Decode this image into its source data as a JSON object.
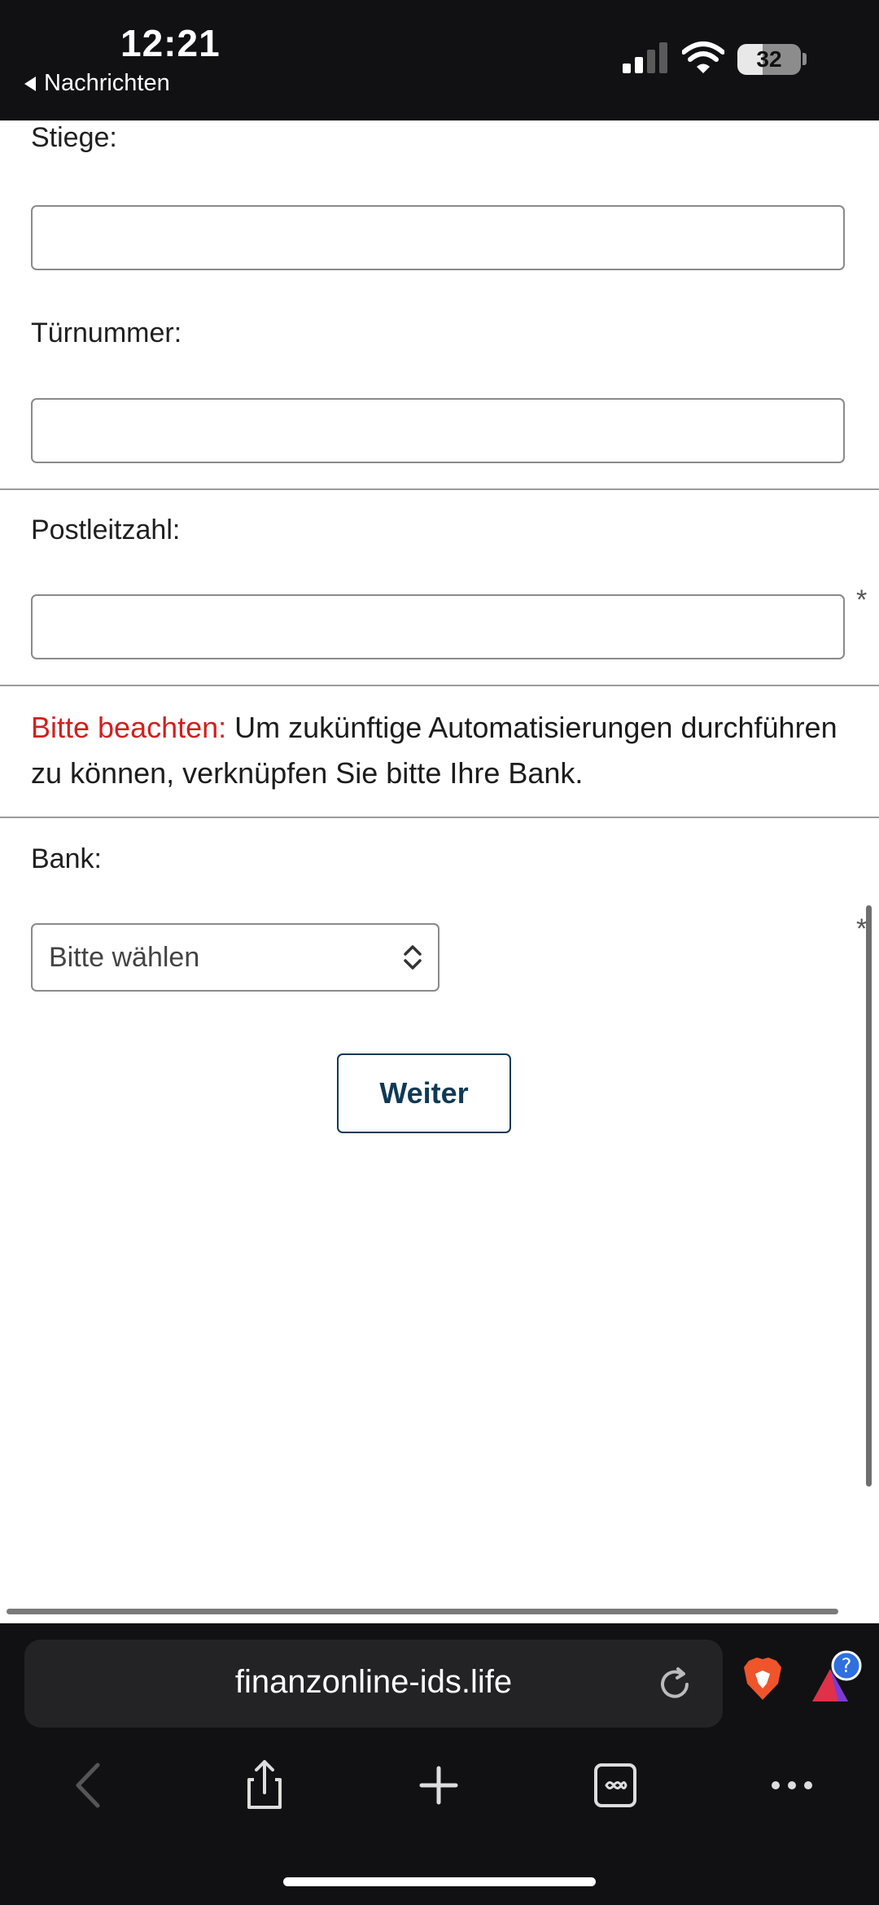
{
  "status_bar": {
    "time": "12:21",
    "back_label": "Nachrichten",
    "battery": "32",
    "icons": [
      "signal-icon",
      "wifi-icon",
      "battery-icon"
    ]
  },
  "form": {
    "stiege_label": "Stiege:",
    "tuernummer_label": "Türnummer:",
    "plz_label": "Postleitzahl:",
    "required_mark": "*",
    "notice_prefix": "Bitte beachten:",
    "notice_text": " Um zukünftige Automatisierungen durchführen zu können, verknüpfen Sie bitte Ihre Bank.",
    "bank_label": "Bank:",
    "bank_select_value": "Bitte wählen",
    "submit_label": "Weiter"
  },
  "browser": {
    "url": "finanzonline-ids.life",
    "icons": [
      "reload-icon",
      "brave-shield-icon",
      "rewards-icon",
      "back-icon",
      "share-icon",
      "new-tab-icon",
      "tabs-icon",
      "more-icon"
    ]
  },
  "colors": {
    "notice_accent": "#d21f1f",
    "button_border": "#0f3a55",
    "chrome_bg": "#111114"
  }
}
